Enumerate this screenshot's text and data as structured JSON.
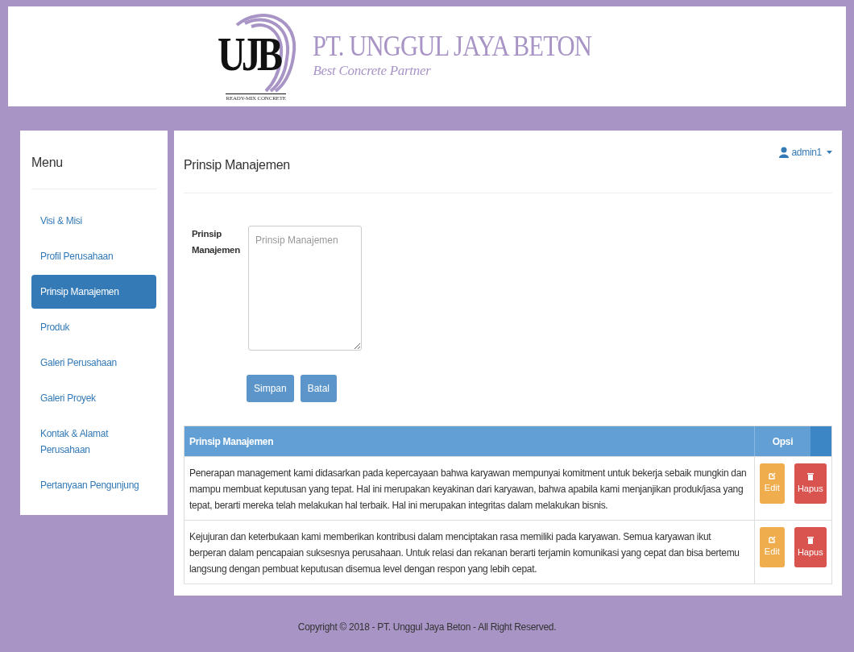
{
  "header": {
    "logo_letters": "UJB",
    "logo_caption": "READY-MIX CONCRETE",
    "company": "PT. UNGGUL JAYA BETON",
    "tagline": "Best Concrete Partner"
  },
  "sidebar": {
    "title": "Menu",
    "items": [
      {
        "label": "Visi & Misi",
        "selected": false
      },
      {
        "label": "Profil Perusahaan",
        "selected": false
      },
      {
        "label": "Prinsip Manajemen",
        "selected": true
      },
      {
        "label": "Produk",
        "selected": false
      },
      {
        "label": "Galeri Perusahaan",
        "selected": false
      },
      {
        "label": "Galeri Proyek",
        "selected": false
      },
      {
        "label": "Kontak & Alamat Perusahaan",
        "selected": false
      },
      {
        "label": "Pertanyaan Pengunjung",
        "selected": false
      }
    ]
  },
  "user": {
    "name": "admin1"
  },
  "page_title": "Prinsip Manajemen",
  "form": {
    "label": "Prinsip Manajemen",
    "placeholder": "Prinsip Manajemen",
    "buttons": [
      "Simpan",
      "Batal"
    ]
  },
  "table": {
    "columns": [
      "Prinsip Manajemen",
      "Opsi"
    ],
    "rows": [
      {
        "text": "Penerapan management kami didasarkan pada kepercayaan bahwa karyawan mempunyai komitment untuk bekerja sebaik mungkin dan mampu membuat keputusan yang tepat. Hal ini merupakan keyakinan dari karyawan, bahwa apabila kami menjanjikan produk/jasa yang tepat, berarti mereka telah melakukan hal terbaik. Hal ini merupakan integritas dalam melakukan bisnis.",
        "edit": "Edit",
        "delete": "Hapus"
      },
      {
        "text": "Kejujuran dan keterbukaan kami memberikan kontribusi dalam menciptakan rasa memiliki pada karyawan. Semua karyawan ikut berperan dalam pencapaian suksesnya perusahaan. Untuk relasi dan rekanan berarti terjamin komunikasi yang cepat dan bisa bertemu langsung dengan pembuat keputusan disemua level dengan respon yang lebih cepat.",
        "edit": "Edit",
        "delete": "Hapus"
      }
    ]
  },
  "footer": "Copyright © 2018 - PT. Unggul Jaya Beton - All Right Reserved."
}
